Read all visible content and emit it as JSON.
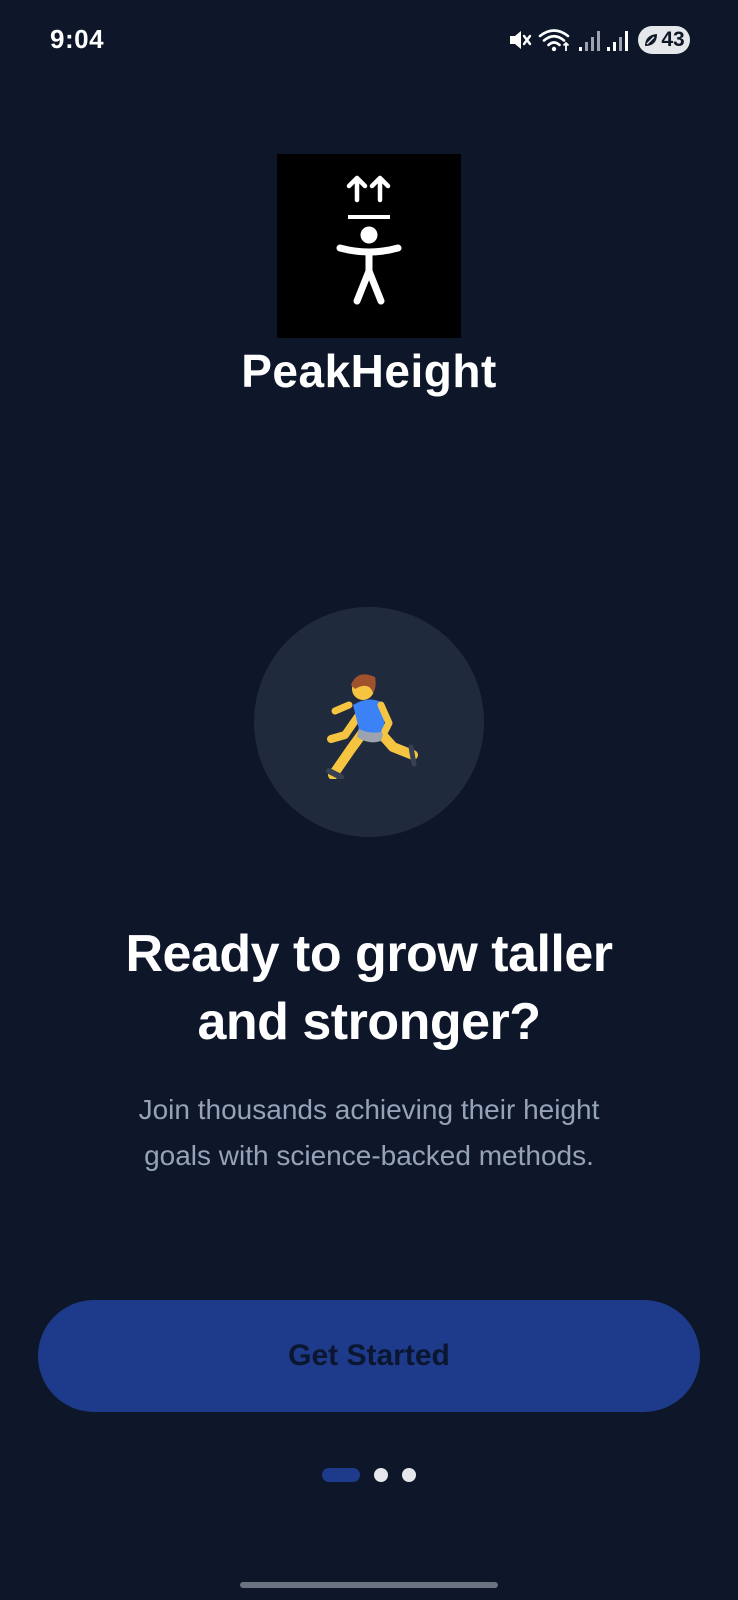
{
  "status_bar": {
    "time": "9:04",
    "battery_level": "43",
    "icons": [
      "mute-icon",
      "wifi-icon",
      "signal-icon",
      "signal-icon",
      "battery-saver-icon"
    ]
  },
  "app": {
    "name": "PeakHeight",
    "logo_icon": "height-growth-icon"
  },
  "hero": {
    "icon": "person-running-icon"
  },
  "onboarding": {
    "headline_line1": "Ready to grow taller",
    "headline_line2": "and stronger?",
    "subtext_line1": "Join thousands achieving their height",
    "subtext_line2": "goals with science-backed methods."
  },
  "cta": {
    "label": "Get Started"
  },
  "pager": {
    "total_pages": 3,
    "active_page": 1
  },
  "colors": {
    "background": "#0e172a",
    "primary": "#1e3a8a",
    "circle": "#1f2a3c",
    "muted_text": "#94a3b8"
  }
}
